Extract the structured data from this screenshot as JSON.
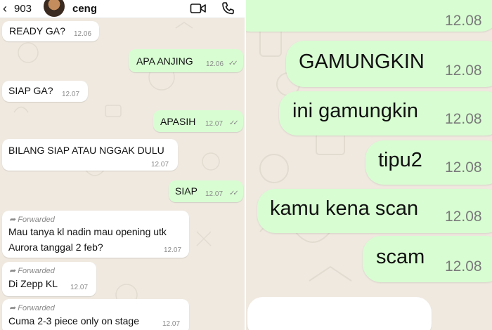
{
  "header": {
    "back_count": "903",
    "contact_name": "ceng"
  },
  "messages": [
    {
      "dir": "in",
      "text": "READY GA?",
      "time": "12.06"
    },
    {
      "dir": "out",
      "text": "APA ANJING",
      "time": "12.06"
    },
    {
      "dir": "in",
      "text": "SIAP GA?",
      "time": "12.07"
    },
    {
      "dir": "out",
      "text": "APASIH",
      "time": "12.07"
    },
    {
      "dir": "in",
      "text": "BILANG SIAP ATAU NGGAK DULU",
      "time": "12.07"
    },
    {
      "dir": "out",
      "text": "SIAP",
      "time": "12.07"
    },
    {
      "dir": "in",
      "forwarded": "Forwarded",
      "text_line1": "Mau tanya kl nadin mau opening utk",
      "text_line2": "Aurora tanggal 2 feb?",
      "time": "12.07"
    },
    {
      "dir": "in",
      "forwarded": "Forwarded",
      "text": "Di Zepp KL",
      "time": "12.07"
    },
    {
      "dir": "in",
      "forwarded": "Forwarded",
      "text": "Cuma 2-3 piece only on stage",
      "time": "12.07"
    }
  ],
  "zoomed": [
    {
      "text": "",
      "time": "12.08"
    },
    {
      "text": "GAMUNGKIN",
      "time": "12.08"
    },
    {
      "text": "ini gamungkin",
      "time": "12.08"
    },
    {
      "text": "tipu2",
      "time": "12.08"
    },
    {
      "text": "kamu kena scan",
      "time": "12.08"
    },
    {
      "text": "scam",
      "time": "12.08"
    }
  ],
  "colors": {
    "outgoing_bubble": "#d8fdd2",
    "incoming_bubble": "#ffffff",
    "wallpaper": "#efe9e0"
  },
  "icons": [
    "back-chevron-icon",
    "video-call-icon",
    "voice-call-icon",
    "double-check-icon",
    "forward-arrow-icon"
  ]
}
